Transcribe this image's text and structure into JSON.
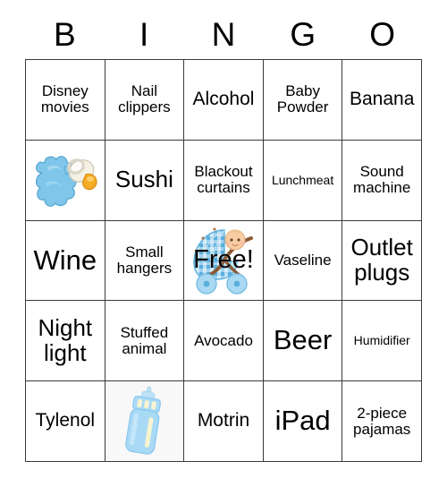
{
  "card": {
    "title_letters": [
      "B",
      "I",
      "N",
      "G",
      "O"
    ],
    "free_label": "Free!",
    "colors": {
      "background": "#ffffff",
      "grid_line": "#3a3a3a",
      "text": "#000000",
      "bottle_blue": "#a9daf5",
      "bottle_highlight": "#f7f4cf",
      "bottle_cell_bg": "#f8f8f8",
      "pacifier_ribbon_blue": "#76c3e8",
      "pacifier_shield": "#f2efe2",
      "pacifier_nipple": "#f5ab24",
      "stroller_gingham": "#7cc0e8",
      "stroller_handle": "#8a5a35",
      "baby_skin": "#f6c9a0"
    },
    "rows": [
      [
        {
          "text": "Disney movies",
          "size": "sm",
          "type": "text"
        },
        {
          "text": "Nail clippers",
          "size": "sm",
          "type": "text"
        },
        {
          "text": "Alcohol",
          "size": "md",
          "type": "text"
        },
        {
          "text": "Baby Powder",
          "size": "sm",
          "type": "text"
        },
        {
          "text": "Banana",
          "size": "md",
          "type": "text"
        }
      ],
      [
        {
          "text": "",
          "size": "sm",
          "type": "image",
          "image": "pacifier-image"
        },
        {
          "text": "Sushi",
          "size": "lg",
          "type": "text"
        },
        {
          "text": "Blackout curtains",
          "size": "sm",
          "type": "text"
        },
        {
          "text": "Lunchmeat",
          "size": "xs",
          "type": "text"
        },
        {
          "text": "Sound machine",
          "size": "sm",
          "type": "text"
        }
      ],
      [
        {
          "text": "Wine",
          "size": "xl",
          "type": "text"
        },
        {
          "text": "Small hangers",
          "size": "sm",
          "type": "text"
        },
        {
          "text": "Free!",
          "size": "lg",
          "type": "free",
          "image": "baby-stroller-image"
        },
        {
          "text": "Vaseline",
          "size": "sm",
          "type": "text"
        },
        {
          "text": "Outlet plugs",
          "size": "lg",
          "type": "text"
        }
      ],
      [
        {
          "text": "Night light",
          "size": "lg",
          "type": "text"
        },
        {
          "text": "Stuffed animal",
          "size": "sm",
          "type": "text"
        },
        {
          "text": "Avocado",
          "size": "sm",
          "type": "text"
        },
        {
          "text": "Beer",
          "size": "xl",
          "type": "text"
        },
        {
          "text": "Humidifier",
          "size": "xs",
          "type": "text"
        }
      ],
      [
        {
          "text": "Tylenol",
          "size": "md",
          "type": "text"
        },
        {
          "text": "",
          "size": "sm",
          "type": "image",
          "image": "baby-bottle-image"
        },
        {
          "text": "Motrin",
          "size": "md",
          "type": "text"
        },
        {
          "text": "iPad",
          "size": "xl",
          "type": "text"
        },
        {
          "text": "2-piece pajamas",
          "size": "sm",
          "type": "text"
        }
      ]
    ]
  }
}
